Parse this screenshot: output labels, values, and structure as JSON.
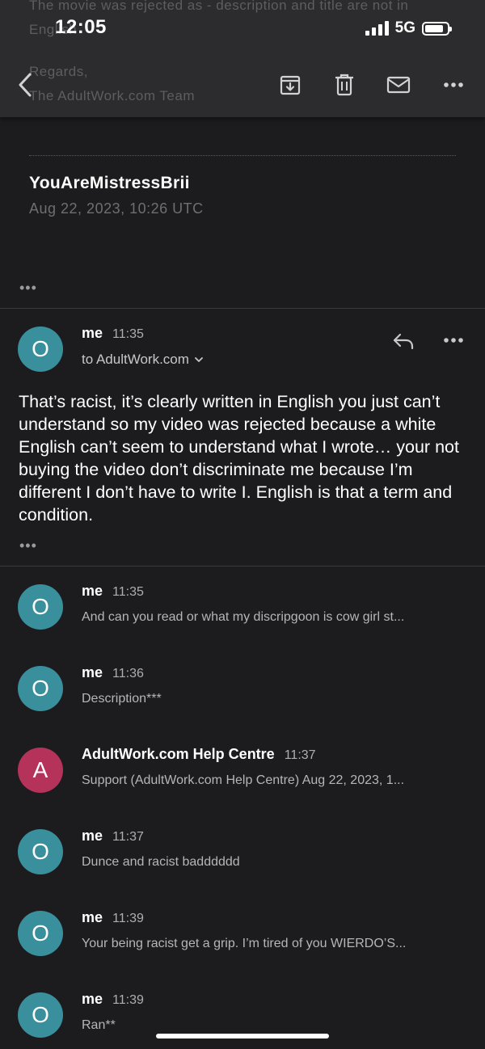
{
  "status": {
    "time": "12:05",
    "network": "5G",
    "battery_level": 0.85
  },
  "ghost_header": {
    "line1": "The movie was rejected as - description and title are not in",
    "line2": "English",
    "regards": "Regards,",
    "team": "The AdultWork.com Team"
  },
  "toolbar": {
    "icons": [
      "back-chevron-icon",
      "archive-icon",
      "trash-icon",
      "mail-icon",
      "more-icon"
    ]
  },
  "previous_email": {
    "sender": "YouAreMistressBrii",
    "date": "Aug 22, 2023, 10:26 UTC",
    "more": "•••"
  },
  "expanded_message": {
    "avatar_letter": "O",
    "sender": "me",
    "time": "11:35",
    "to": "to AdultWork.com",
    "body": "That’s racist, it’s clearly written in English you just can’t understand so my video was rejected because a white English can’t seem to understand what I wrote… your not buying the video don’t discriminate me because I’m different I don’t have to write I. English is that a term and condition.",
    "more": "•••"
  },
  "messages": [
    {
      "avatar_letter": "O",
      "sender": "me",
      "time": "11:35",
      "snippet": "And can you read or what my discripgoon is cow girl st..."
    },
    {
      "avatar_letter": "O",
      "sender": "me",
      "time": "11:36",
      "snippet": "Description***"
    },
    {
      "avatar_letter": "A",
      "sender": "AdultWork.com Help Centre",
      "time": "11:37",
      "snippet": "Support (AdultWork.com Help Centre) Aug 22, 2023, 1..."
    },
    {
      "avatar_letter": "O",
      "sender": "me",
      "time": "11:37",
      "snippet": "Dunce and racist badddddd"
    },
    {
      "avatar_letter": "O",
      "sender": "me",
      "time": "11:39",
      "snippet": "Your being racist get a grip. I’m tired of you WIERDO’S..."
    },
    {
      "avatar_letter": "O",
      "sender": "me",
      "time": "11:39",
      "snippet": "Ran**"
    }
  ],
  "colors": {
    "avatar_me": "#3a8f9c",
    "avatar_support": "#b5325a",
    "background": "#1c1c1e",
    "header": "#2c2c2e"
  }
}
